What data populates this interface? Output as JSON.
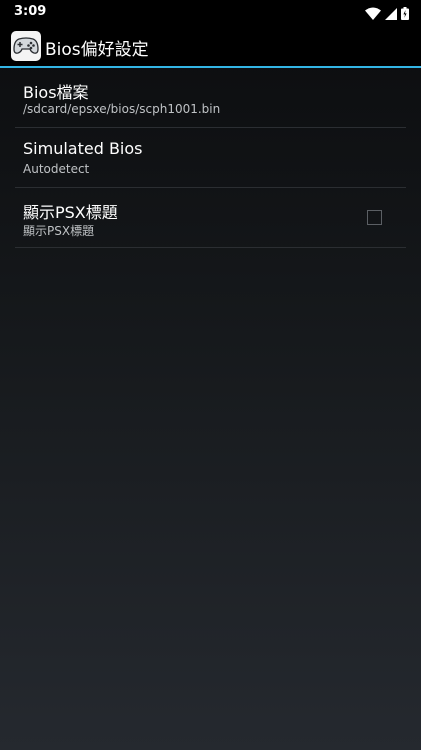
{
  "status_bar": {
    "time": "3:09",
    "icons": [
      "wifi-icon",
      "cell-signal-icon",
      "battery-icon"
    ]
  },
  "action_bar": {
    "title": "Bios偏好設定",
    "icon": "gamepad-icon",
    "accent_color": "#33b5e5"
  },
  "preferences": [
    {
      "title": "Bios檔案",
      "summary": "/sdcard/epsxe/bios/scph1001.bin"
    },
    {
      "title": "Simulated Bios",
      "summary": "Autodetect"
    },
    {
      "title": "顯示PSX標題",
      "summary": "顯示PSX標題",
      "checked": false
    }
  ]
}
